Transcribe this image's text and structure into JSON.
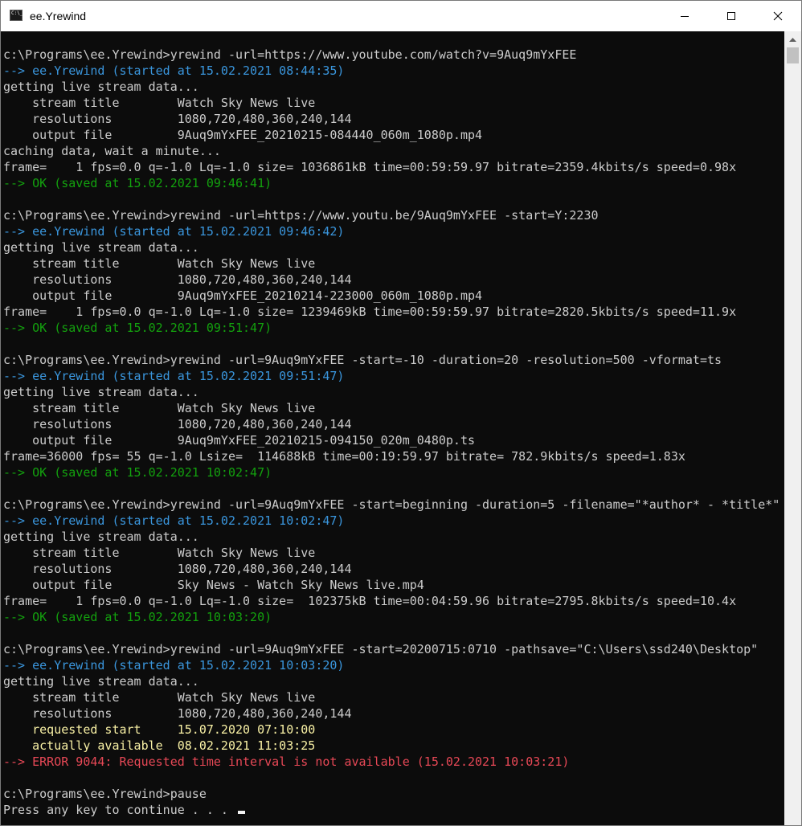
{
  "window": {
    "title": "ee.Yrewind",
    "icon_text": "C:\\_"
  },
  "console": {
    "lines": [
      {
        "text": "c:\\Programs\\ee.Yrewind>yrewind -url=https://www.youtube.com/watch?v=9Auq9mYxFEE",
        "color": "default"
      },
      {
        "text": "--> ee.Yrewind (started at 15.02.2021 08:44:35)",
        "color": "cyan"
      },
      {
        "text": "getting live stream data...",
        "color": "default"
      },
      {
        "text": "    stream title        Watch Sky News live",
        "color": "default"
      },
      {
        "text": "    resolutions         1080,720,480,360,240,144",
        "color": "default"
      },
      {
        "text": "    output file         9Auq9mYxFEE_20210215-084440_060m_1080p.mp4",
        "color": "default"
      },
      {
        "text": "caching data, wait a minute...",
        "color": "default"
      },
      {
        "text": "frame=    1 fps=0.0 q=-1.0 Lq=-1.0 size= 1036861kB time=00:59:59.97 bitrate=2359.4kbits/s speed=0.98x",
        "color": "default"
      },
      {
        "text": "--> OK (saved at 15.02.2021 09:46:41)",
        "color": "green"
      },
      {
        "text": "",
        "color": "default"
      },
      {
        "text": "c:\\Programs\\ee.Yrewind>yrewind -url=https://www.youtu.be/9Auq9mYxFEE -start=Y:2230",
        "color": "default"
      },
      {
        "text": "--> ee.Yrewind (started at 15.02.2021 09:46:42)",
        "color": "cyan"
      },
      {
        "text": "getting live stream data...",
        "color": "default"
      },
      {
        "text": "    stream title        Watch Sky News live",
        "color": "default"
      },
      {
        "text": "    resolutions         1080,720,480,360,240,144",
        "color": "default"
      },
      {
        "text": "    output file         9Auq9mYxFEE_20210214-223000_060m_1080p.mp4",
        "color": "default"
      },
      {
        "text": "frame=    1 fps=0.0 q=-1.0 Lq=-1.0 size= 1239469kB time=00:59:59.97 bitrate=2820.5kbits/s speed=11.9x",
        "color": "default"
      },
      {
        "text": "--> OK (saved at 15.02.2021 09:51:47)",
        "color": "green"
      },
      {
        "text": "",
        "color": "default"
      },
      {
        "text": "c:\\Programs\\ee.Yrewind>yrewind -url=9Auq9mYxFEE -start=-10 -duration=20 -resolution=500 -vformat=ts",
        "color": "default"
      },
      {
        "text": "--> ee.Yrewind (started at 15.02.2021 09:51:47)",
        "color": "cyan"
      },
      {
        "text": "getting live stream data...",
        "color": "default"
      },
      {
        "text": "    stream title        Watch Sky News live",
        "color": "default"
      },
      {
        "text": "    resolutions         1080,720,480,360,240,144",
        "color": "default"
      },
      {
        "text": "    output file         9Auq9mYxFEE_20210215-094150_020m_0480p.ts",
        "color": "default"
      },
      {
        "text": "frame=36000 fps= 55 q=-1.0 Lsize=  114688kB time=00:19:59.97 bitrate= 782.9kbits/s speed=1.83x",
        "color": "default"
      },
      {
        "text": "--> OK (saved at 15.02.2021 10:02:47)",
        "color": "green"
      },
      {
        "text": "",
        "color": "default"
      },
      {
        "text": "c:\\Programs\\ee.Yrewind>yrewind -url=9Auq9mYxFEE -start=beginning -duration=5 -filename=\"*author* - *title*\"",
        "color": "default"
      },
      {
        "text": "--> ee.Yrewind (started at 15.02.2021 10:02:47)",
        "color": "cyan"
      },
      {
        "text": "getting live stream data...",
        "color": "default"
      },
      {
        "text": "    stream title        Watch Sky News live",
        "color": "default"
      },
      {
        "text": "    resolutions         1080,720,480,360,240,144",
        "color": "default"
      },
      {
        "text": "    output file         Sky News - Watch Sky News live.mp4",
        "color": "default"
      },
      {
        "text": "frame=    1 fps=0.0 q=-1.0 Lq=-1.0 size=  102375kB time=00:04:59.96 bitrate=2795.8kbits/s speed=10.4x",
        "color": "default"
      },
      {
        "text": "--> OK (saved at 15.02.2021 10:03:20)",
        "color": "green"
      },
      {
        "text": "",
        "color": "default"
      },
      {
        "text": "c:\\Programs\\ee.Yrewind>yrewind -url=9Auq9mYxFEE -start=20200715:0710 -pathsave=\"C:\\Users\\ssd240\\Desktop\"",
        "color": "default"
      },
      {
        "text": "--> ee.Yrewind (started at 15.02.2021 10:03:20)",
        "color": "cyan"
      },
      {
        "text": "getting live stream data...",
        "color": "default"
      },
      {
        "text": "    stream title        Watch Sky News live",
        "color": "default"
      },
      {
        "text": "    resolutions         1080,720,480,360,240,144",
        "color": "default"
      },
      {
        "text": "    requested start     15.07.2020 07:10:00",
        "color": "yellow"
      },
      {
        "text": "    actually available  08.02.2021 11:03:25",
        "color": "yellow"
      },
      {
        "text": "--> ERROR 9044: Requested time interval is not available (15.02.2021 10:03:21)",
        "color": "red"
      },
      {
        "text": "",
        "color": "default"
      },
      {
        "text": "c:\\Programs\\ee.Yrewind>pause",
        "color": "default"
      },
      {
        "text": "Press any key to continue . . . ",
        "color": "default",
        "cursor": true
      }
    ]
  },
  "colors": {
    "default": "#cccccc",
    "cyan": "#3a96dd",
    "green": "#13a10e",
    "yellow": "#f9f1a5",
    "red": "#e74856",
    "background": "#0c0c0c"
  },
  "controls": {
    "minimize_icon": "minimize-icon",
    "maximize_icon": "maximize-icon",
    "close_icon": "close-icon",
    "scroll_up_icon": "scroll-up-arrow-icon"
  }
}
